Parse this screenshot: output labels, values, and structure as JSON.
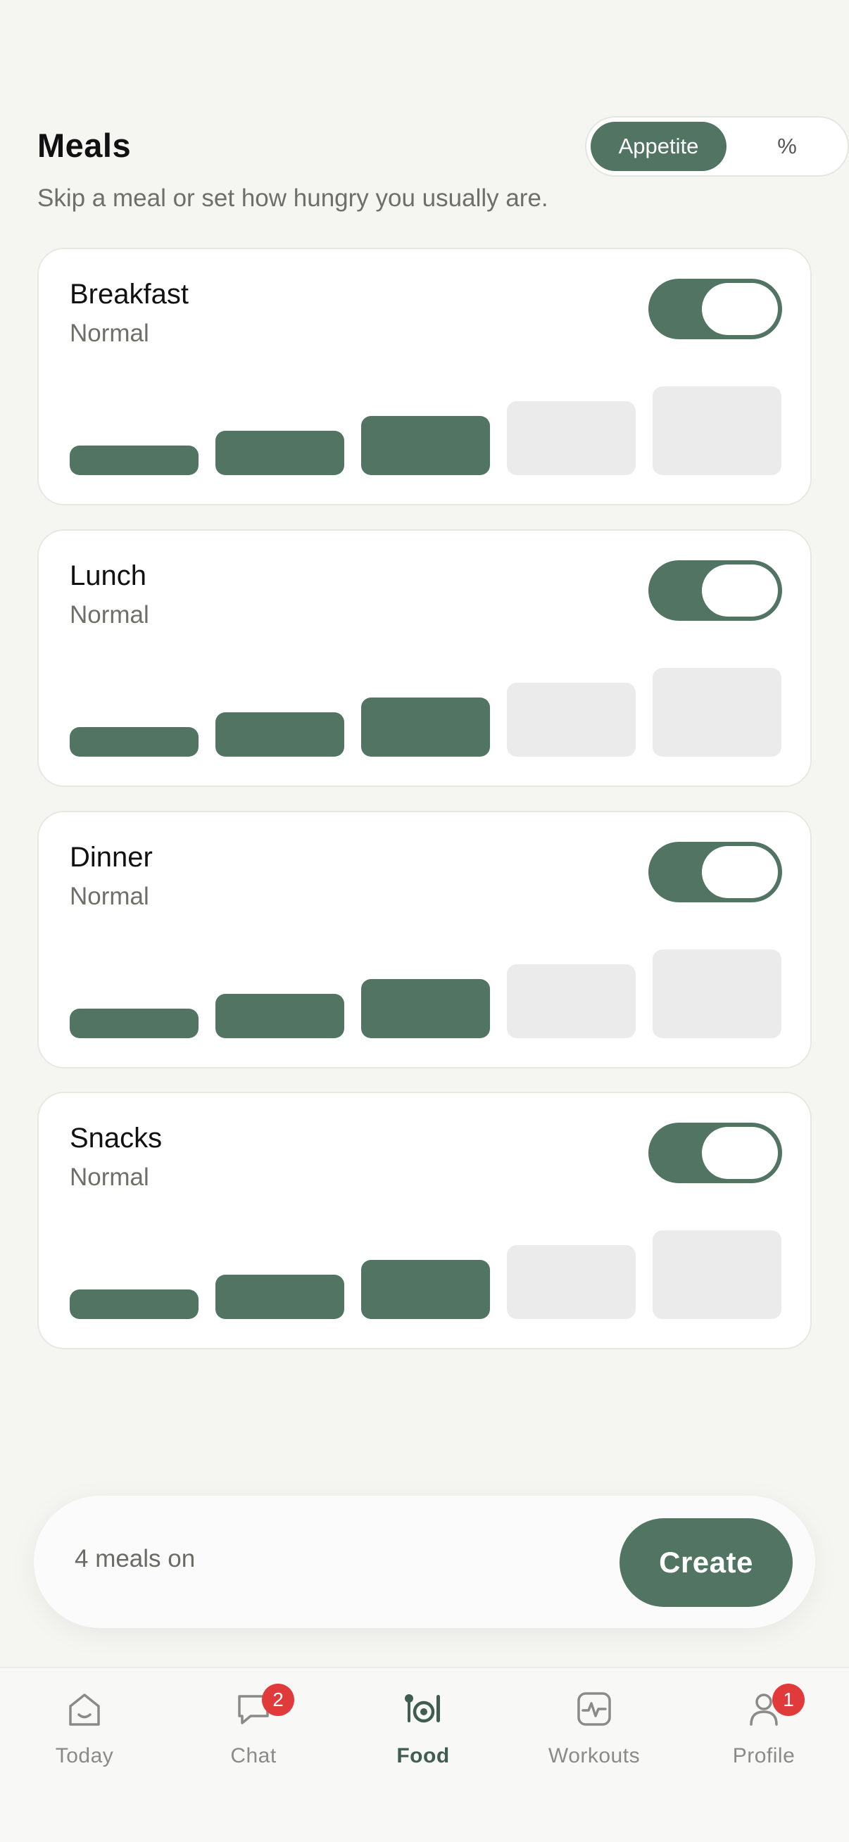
{
  "header": {
    "title": "Meals",
    "subtitle": "Skip a meal or set how hungry you usually are.",
    "segment": {
      "active_label": "Appetite",
      "inactive_label": "%"
    }
  },
  "meals": [
    {
      "name": "Breakfast",
      "level_label": "Normal",
      "enabled": true,
      "level": 3,
      "max_level": 5
    },
    {
      "name": "Lunch",
      "level_label": "Normal",
      "enabled": true,
      "level": 3,
      "max_level": 5
    },
    {
      "name": "Dinner",
      "level_label": "Normal",
      "enabled": true,
      "level": 3,
      "max_level": 5
    },
    {
      "name": "Snacks",
      "level_label": "Normal",
      "enabled": true,
      "level": 3,
      "max_level": 5
    }
  ],
  "footer": {
    "summary": "4 meals on",
    "create_label": "Create"
  },
  "tabbar": {
    "items": [
      {
        "label": "Today",
        "icon": "home-icon",
        "badge": ""
      },
      {
        "label": "Chat",
        "icon": "chat-icon",
        "badge": "2"
      },
      {
        "label": "Food",
        "icon": "food-icon",
        "badge": "",
        "active": true
      },
      {
        "label": "Workouts",
        "icon": "activity-icon",
        "badge": ""
      },
      {
        "label": "Profile",
        "icon": "profile-icon",
        "badge": "1"
      }
    ]
  },
  "colors": {
    "accent": "#527563",
    "background": "#f5f5f2",
    "inactive_bar": "#eaebea",
    "badge": "#e03a3a"
  }
}
